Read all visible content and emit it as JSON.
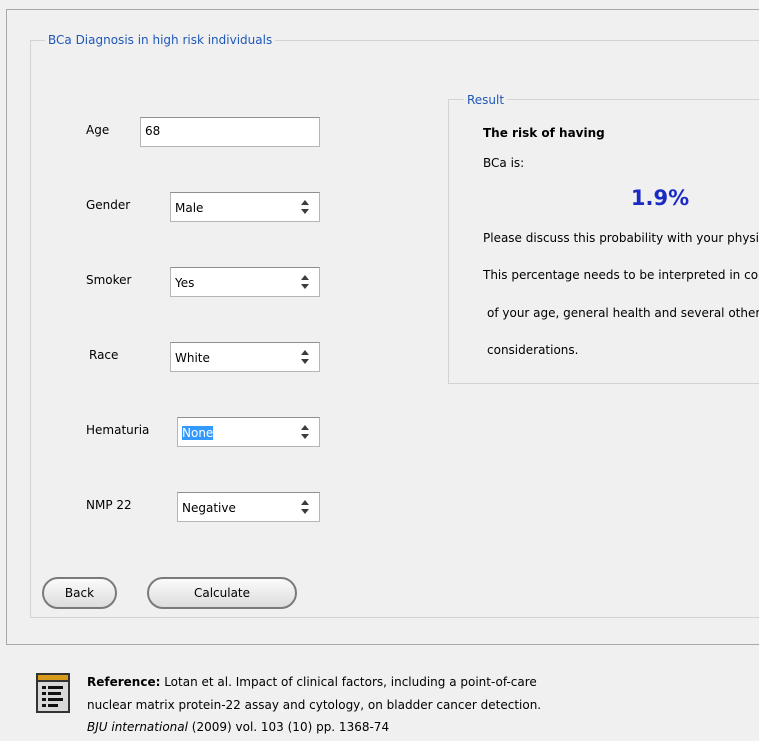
{
  "form": {
    "title": "BCa Diagnosis in high risk individuals",
    "fields": {
      "age": {
        "label": "Age",
        "value": "68"
      },
      "gender": {
        "label": "Gender",
        "value": "Male"
      },
      "smoker": {
        "label": "Smoker",
        "value": "Yes"
      },
      "race": {
        "label": "Race",
        "value": "White"
      },
      "hematuria": {
        "label": "Hematuria",
        "value": "None"
      },
      "nmp22": {
        "label": "NMP 22",
        "value": "Negative"
      }
    },
    "buttons": {
      "back": "Back",
      "calculate": "Calculate"
    }
  },
  "result": {
    "title": "Result",
    "line1": "The risk of having",
    "line2": "BCa is:",
    "percentage": "1.9%",
    "line3": "Please discuss this probability with your physician.",
    "line4": "This percentage needs to be interpreted in context",
    "line5": "of your age, general health and several other",
    "line6": "considerations."
  },
  "reference": {
    "label": "Reference:",
    "text1": " Lotan et al. Impact of clinical factors, including a point-of-care",
    "text2": "nuclear matrix protein-22 assay and cytology, on bladder cancer detection.",
    "journal": "BJU international",
    "citation": " (2009) vol. 103 (10) pp. 1368-74"
  },
  "colors": {
    "group_title": "#1f58b7",
    "percentage": "#1a2bc4",
    "selection": "#3399ff"
  },
  "icons": {
    "select_arrow": "up-down-arrows-icon",
    "reference": "document-icon"
  }
}
